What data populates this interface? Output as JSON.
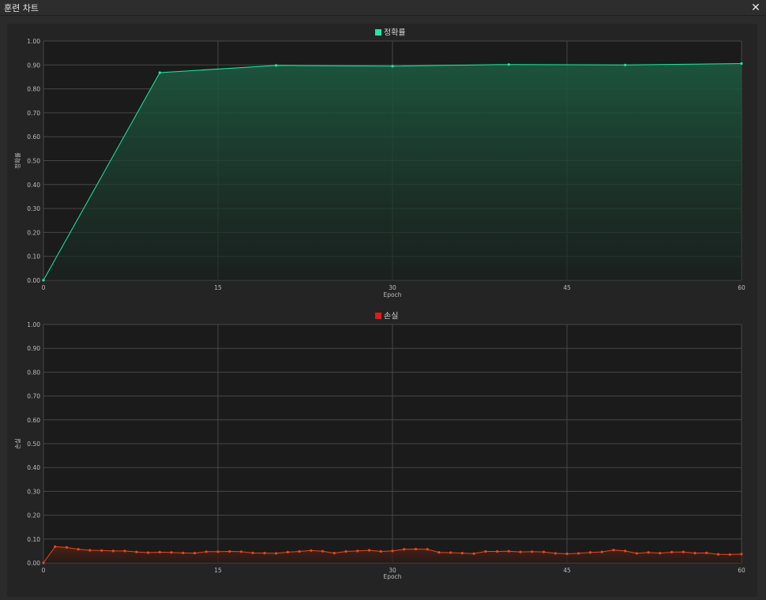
{
  "window": {
    "title": "훈련 차트",
    "close_icon": "close-icon"
  },
  "theme": {
    "plot_bg": "#1b1b1b",
    "grid": "#474747",
    "tick_text": "#bdbdbd",
    "accuracy_color": "#1de9a4",
    "loss_color": "#e24a1e",
    "loss_legend_color": "#e01b1b"
  },
  "chart_data": [
    {
      "type": "area",
      "title": "",
      "xlabel": "Epoch",
      "ylabel": "정확률",
      "xlim": [
        0,
        60
      ],
      "ylim": [
        0,
        1
      ],
      "xticks": [
        "0",
        "15",
        "30",
        "45",
        "60"
      ],
      "yticks": [
        "0.00",
        "0.10",
        "0.20",
        "0.30",
        "0.40",
        "0.50",
        "0.60",
        "0.70",
        "0.80",
        "0.90",
        "1.00"
      ],
      "grid": true,
      "legend": "top-center",
      "series": [
        {
          "name": "정확률",
          "x": [
            0,
            10,
            20,
            30,
            40,
            50,
            60
          ],
          "values": [
            0.0,
            0.868,
            0.898,
            0.895,
            0.902,
            0.9,
            0.906
          ]
        }
      ]
    },
    {
      "type": "area",
      "title": "",
      "xlabel": "Epoch",
      "ylabel": "손실",
      "xlim": [
        0,
        60
      ],
      "ylim": [
        0,
        1
      ],
      "xticks": [
        "0",
        "15",
        "30",
        "45",
        "60"
      ],
      "yticks": [
        "0.00",
        "0.10",
        "0.20",
        "0.30",
        "0.40",
        "0.50",
        "0.60",
        "0.70",
        "0.80",
        "0.90",
        "1.00"
      ],
      "grid": true,
      "legend": "top-center",
      "series": [
        {
          "name": "손실",
          "x": [
            0,
            1,
            2,
            3,
            4,
            5,
            6,
            7,
            8,
            9,
            10,
            11,
            12,
            13,
            14,
            15,
            16,
            17,
            18,
            19,
            20,
            21,
            22,
            23,
            24,
            25,
            26,
            27,
            28,
            29,
            30,
            31,
            32,
            33,
            34,
            35,
            36,
            37,
            38,
            39,
            40,
            41,
            42,
            43,
            44,
            45,
            46,
            47,
            48,
            49,
            50,
            51,
            52,
            53,
            54,
            55,
            56,
            57,
            58,
            59,
            60
          ],
          "values": [
            0.0,
            0.068,
            0.065,
            0.057,
            0.053,
            0.052,
            0.05,
            0.05,
            0.046,
            0.043,
            0.045,
            0.044,
            0.042,
            0.041,
            0.047,
            0.047,
            0.048,
            0.047,
            0.042,
            0.041,
            0.04,
            0.045,
            0.048,
            0.052,
            0.049,
            0.041,
            0.048,
            0.05,
            0.053,
            0.048,
            0.05,
            0.057,
            0.058,
            0.057,
            0.044,
            0.043,
            0.041,
            0.039,
            0.048,
            0.048,
            0.049,
            0.046,
            0.047,
            0.046,
            0.04,
            0.038,
            0.04,
            0.044,
            0.046,
            0.054,
            0.05,
            0.04,
            0.044,
            0.041,
            0.045,
            0.046,
            0.041,
            0.042,
            0.036,
            0.035,
            0.037
          ]
        }
      ]
    }
  ]
}
